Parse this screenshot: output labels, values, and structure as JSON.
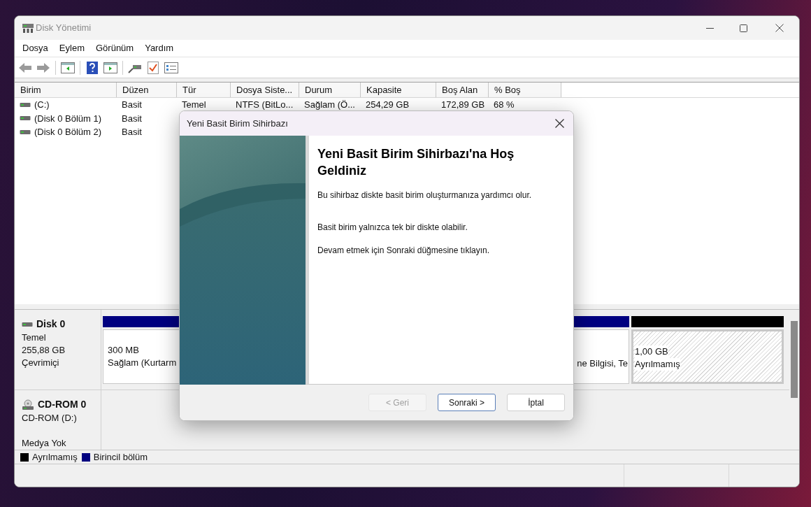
{
  "window": {
    "title": "Disk Yönetimi"
  },
  "menu": [
    "Dosya",
    "Eylem",
    "Görünüm",
    "Yardım"
  ],
  "volume_table": {
    "columns": [
      "Birim",
      "Düzen",
      "Tür",
      "Dosya Siste...",
      "Durum",
      "Kapasite",
      "Boş Alan",
      "% Boş"
    ],
    "rows": [
      {
        "cells": [
          "(C:)",
          "Basit",
          "Temel",
          "NTFS (BitLo...",
          "Sağlam (Ö...",
          "254,29 GB",
          "172,89 GB",
          "68 %"
        ]
      },
      {
        "cells": [
          "(Disk 0 Bölüm 1)",
          "Basit"
        ]
      },
      {
        "cells": [
          "(Disk 0 Bölüm 2)",
          "Basit"
        ]
      }
    ]
  },
  "disks": [
    {
      "kind": "disk",
      "name": "Disk 0",
      "lines": [
        "Temel",
        "255,88 GB",
        "Çevrimiçi"
      ],
      "partitions": [
        {
          "kind": "primary",
          "color": "#000080",
          "size": "300 MB",
          "status": "Sağlam (Kurtarm"
        },
        {
          "kind": "primary_tail",
          "color": "#000080",
          "status": "ne Bilgisi, Te"
        },
        {
          "kind": "unallocated",
          "color": "#000000",
          "size": "1,00 GB",
          "status": "Ayrılmamış"
        }
      ]
    },
    {
      "kind": "cdrom",
      "name": "CD-ROM 0",
      "lines": [
        "CD-ROM (D:)",
        "Medya Yok"
      ]
    }
  ],
  "legend": [
    {
      "label": "Ayrılmamış",
      "color": "#000000"
    },
    {
      "label": "Birincil bölüm",
      "color": "#000080"
    }
  ],
  "dialog": {
    "title": "Yeni Basit Birim Sihirbazı",
    "heading": "Yeni Basit Birim Sihirbazı'na Hoş Geldiniz",
    "paragraphs": [
      "Bu sihirbaz diskte basit birim oluşturmanıza yardımcı olur.",
      "Basit birim yalnızca tek bir diskte olabilir.",
      "Devam etmek için Sonraki düğmesine tıklayın."
    ],
    "buttons": [
      {
        "label": "< Geri",
        "disabled": true,
        "default": false
      },
      {
        "label": "Sonraki >",
        "disabled": false,
        "default": true
      },
      {
        "label": "İptal",
        "disabled": false,
        "default": false
      }
    ]
  }
}
